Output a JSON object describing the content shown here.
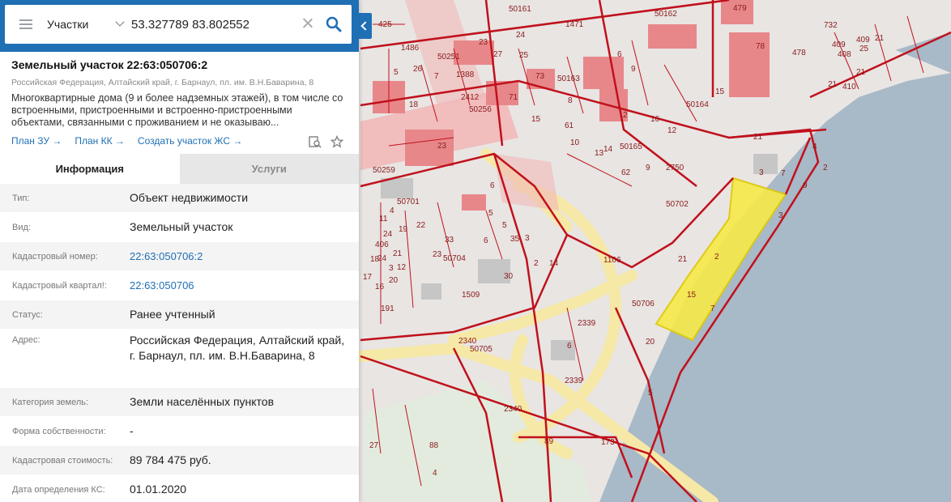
{
  "search": {
    "layer": "Участки",
    "query": "53.327789 83.802552"
  },
  "object": {
    "title": "Земельный участок 22:63:050706:2",
    "address_line": "Российская Федерация, Алтайский край, г. Барнаул, пл. им. В.Н.Баварина, 8",
    "description": "Многоквартирные дома (9 и более надземных этажей), в том числе со встроенными, пристроенными и встроенно-пристроенными объектами, связанными с проживанием и не оказываю...",
    "links": [
      "План ЗУ →",
      "План КК →",
      "Создать участок ЖС →"
    ]
  },
  "tabs": [
    {
      "label": "Информация",
      "active": true
    },
    {
      "label": "Услуги",
      "active": false
    }
  ],
  "rows": [
    {
      "label": "Тип:",
      "value": "Объект недвижимости"
    },
    {
      "label": "Вид:",
      "value": "Земельный участок"
    },
    {
      "label": "Кадастровый номер:",
      "value": "22:63:050706:2"
    },
    {
      "label": "Кадастровый квартал!:",
      "value": "22:63:050706"
    },
    {
      "label": "Статус:",
      "value": "Ранее учтенный"
    },
    {
      "label": "Адрес:",
      "value": "Российская Федерация, Алтайский край, г. Барнаул, пл. им. В.Н.Баварина, 8"
    },
    {
      "label": "Категория земель:",
      "value": "Земли населённых пунктов"
    },
    {
      "label": "Форма собственности:",
      "value": "-"
    },
    {
      "label": "Кадастровая стоимость:",
      "value": "89 784 475 руб."
    },
    {
      "label": "Дата определения КС:",
      "value": "01.01.2020"
    }
  ],
  "map_labels": [
    "50161",
    "50162",
    "479",
    "732",
    "409",
    "21",
    "425",
    "1486",
    "23",
    "24",
    "1471",
    "50251",
    "27",
    "25",
    "1388",
    "6",
    "9",
    "78",
    "478",
    "408",
    "26",
    "5",
    "7",
    "50163",
    "8",
    "410",
    "21",
    "18",
    "2412",
    "50256",
    "73",
    "71",
    "15",
    "50164",
    "15",
    "61",
    "10",
    "2",
    "16",
    "50165",
    "9",
    "12",
    "14",
    "13",
    "62",
    "2750",
    "23",
    "21",
    "3",
    "50259",
    "6",
    "50701",
    "50702",
    "5",
    "33",
    "22",
    "35",
    "50704",
    "24",
    "3",
    "1106",
    "21",
    "2",
    "1509",
    "30",
    "191",
    "50706",
    "7",
    "15",
    "2339",
    "6",
    "20",
    "2340",
    "50705",
    "2339",
    "5",
    "2340",
    "173",
    "89",
    "88",
    "4",
    "27",
    "16",
    "20",
    "14",
    "2",
    "7",
    "3",
    "4",
    "9",
    "12",
    "21",
    "23",
    "18",
    "17",
    "5",
    "3",
    "2",
    "6",
    "25",
    "409",
    "21",
    "406",
    "24",
    "11",
    "19",
    "4",
    "20",
    "26"
  ],
  "colors": {
    "accent": "#1f6fb5",
    "parcel_outline": "#c0111c",
    "selected_fill": "#f7ea48",
    "water": "#a8b9c8"
  }
}
